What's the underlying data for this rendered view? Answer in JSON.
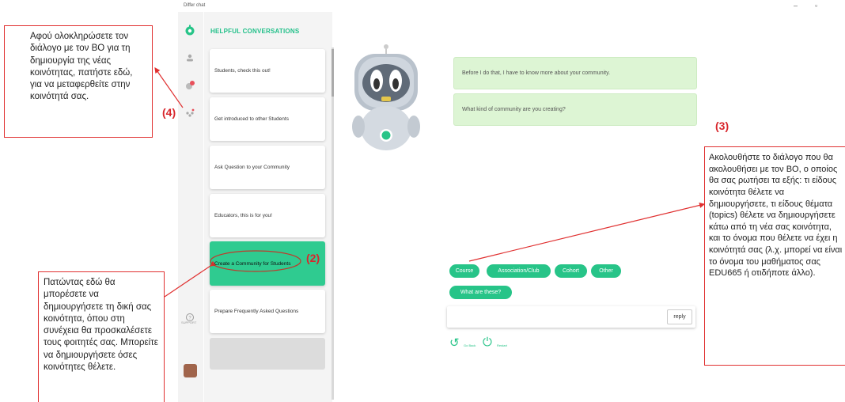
{
  "window": {
    "title": "Differ chat",
    "minimize_icon": "minus",
    "restore_icon": "square"
  },
  "rail": {
    "icons": [
      "logo-icon",
      "profile-icon",
      "notification-icon",
      "community-icon",
      "support-icon"
    ],
    "support_label": "SUPPORT"
  },
  "sidebar": {
    "header": "HELPFUL CONVERSATIONS",
    "items": [
      {
        "label": "Students, check this out!"
      },
      {
        "label": "Get introduced to other Students"
      },
      {
        "label": "Ask Question to your Community"
      },
      {
        "label": "Educators, this is for you!"
      },
      {
        "label": "Create a Community for Students"
      },
      {
        "label": "Prepare Frequently Asked Questions"
      }
    ]
  },
  "chat": {
    "messages": [
      "Before I do that, I have to know more about your community.",
      "What kind of community are you creating?"
    ],
    "options": [
      "Course",
      "Association/Club",
      "Cohort",
      "Other",
      "What are these?"
    ],
    "reply_value": "",
    "reply_button": "reply",
    "go_back_label": "Go Back",
    "restart_label": "Restart"
  },
  "annotations": {
    "note1": "Αφού ολοκληρώσετε τον διάλογο με τον BO για τη δημιουργία της νέας κοινότητας, πατήστε εδώ, για να μεταφερθείτε στην κοινότητά σας.",
    "tag1": "(4)",
    "tag2": "(2)",
    "note2": "Πατώντας εδώ θα μπορέσετε να δημιουργήσετε τη δική σας κοινότητα, όπου στη συνέχεια θα προσκαλέσετε τους φοιτητές σας. Μπορείτε να δημιουργήσετε όσες κοινότητες θέλετε.",
    "tag3": "(3)",
    "note3": "Ακολουθήστε το διάλογο που θα ακολουθήσει με τον BO, ο οποίος θα σας ρωτήσει τα εξής: τι είδους κοινότητα θέλετε να δημιουργήσετε, τι είδους θέματα (topics) θέλετε να δημιουργήσετε κάτω από τη νέα σας κοινότητα, και το όνομα που θέλετε να έχει η κοινότητά σας (λ.χ. μπορεί να είναι το όνομα του μαθήματος σας EDU665 ή οτιδήποτε άλλο)."
  },
  "colors": {
    "accent": "#27c488",
    "annotation": "#e03030",
    "bubble": "#ddf5d4"
  }
}
